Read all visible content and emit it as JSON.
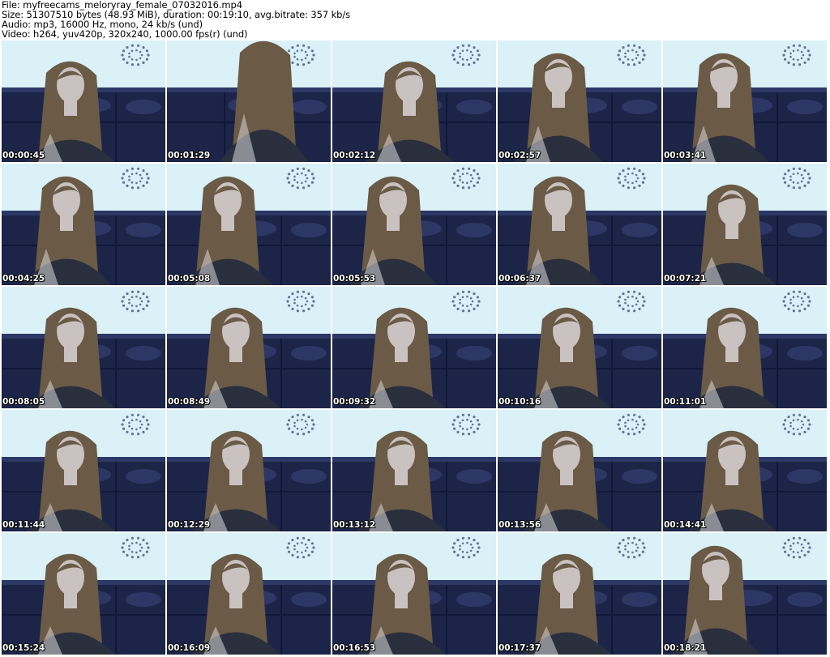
{
  "header": {
    "file_line": "File: myfreecams_meloryray_female_07032016.mp4",
    "size_line": "Size: 51307510 bytes (48.93 MiB), duration: 00:19:10, avg.bitrate: 357 kb/s",
    "audio_line": "Audio: mp3, 16000 Hz, mono, 24 kb/s (und)",
    "video_line": "Video: h264, yuv420p, 320x240, 1000.00 fps(r) (und)"
  },
  "thumbnails": [
    {
      "timestamp": "00:00:45"
    },
    {
      "timestamp": "00:01:29"
    },
    {
      "timestamp": "00:02:12"
    },
    {
      "timestamp": "00:02:57"
    },
    {
      "timestamp": "00:03:41"
    },
    {
      "timestamp": "00:04:25"
    },
    {
      "timestamp": "00:05:08"
    },
    {
      "timestamp": "00:05:53"
    },
    {
      "timestamp": "00:06:37"
    },
    {
      "timestamp": "00:07:21"
    },
    {
      "timestamp": "00:08:05"
    },
    {
      "timestamp": "00:08:49"
    },
    {
      "timestamp": "00:09:32"
    },
    {
      "timestamp": "00:10:16"
    },
    {
      "timestamp": "00:11:01"
    },
    {
      "timestamp": "00:11:44"
    },
    {
      "timestamp": "00:12:29"
    },
    {
      "timestamp": "00:13:12"
    },
    {
      "timestamp": "00:13:56"
    },
    {
      "timestamp": "00:14:41"
    },
    {
      "timestamp": "00:15:24"
    },
    {
      "timestamp": "00:16:09"
    },
    {
      "timestamp": "00:16:53"
    },
    {
      "timestamp": "00:17:37"
    },
    {
      "timestamp": "00:18:21"
    }
  ],
  "colors": {
    "wall": "#d9f1f7",
    "sofa": "#1c2547",
    "hair": "#6b5a45",
    "skin": "#c9c2c0",
    "timestamp_text": "#ffffff"
  }
}
